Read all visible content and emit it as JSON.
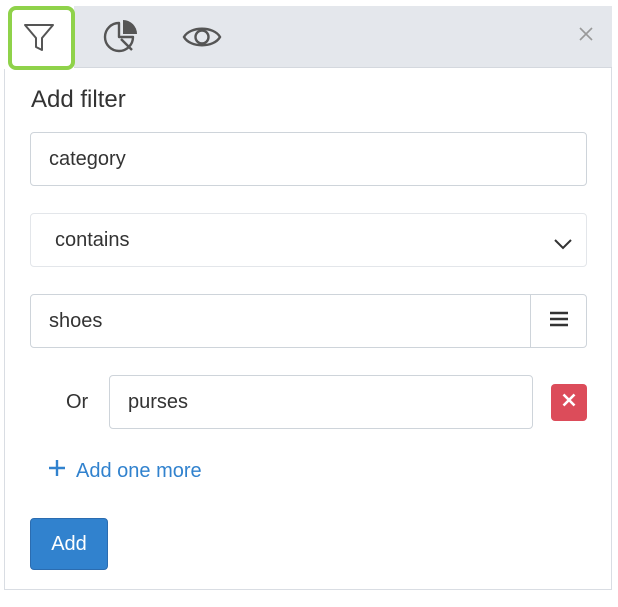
{
  "tabs": [
    {
      "icon": "filter-icon",
      "active": true
    },
    {
      "icon": "pie-chart-icon",
      "active": false
    },
    {
      "icon": "eye-icon",
      "active": false
    }
  ],
  "close_icon": "close-icon",
  "form": {
    "title": "Add filter",
    "field_value": "category",
    "operator_value": "contains",
    "value_1": "shoes",
    "or_label": "Or",
    "value_2": "purses",
    "add_more_label": "Add one more",
    "add_button_label": "Add"
  },
  "colors": {
    "accent": "#3182ce",
    "danger": "#dc4c5a",
    "focus_ring": "#8fd24a",
    "topbar": "#e4e7ec"
  }
}
